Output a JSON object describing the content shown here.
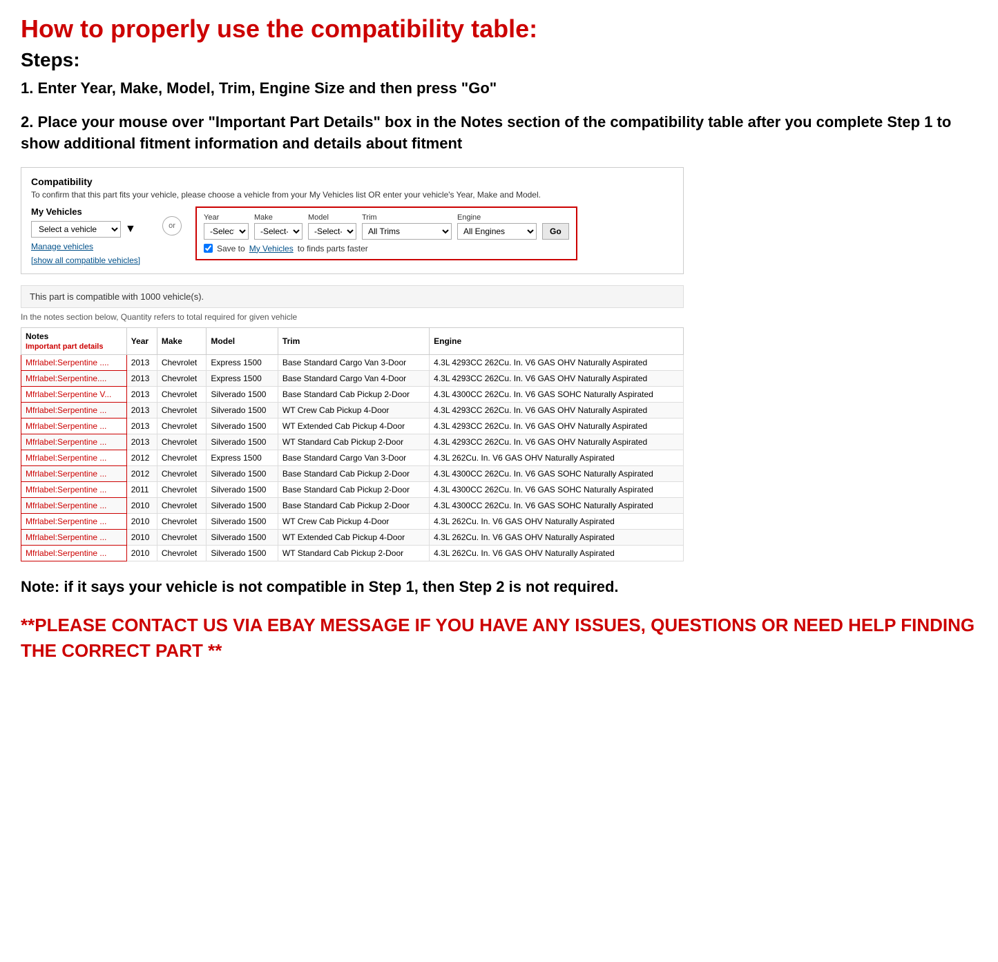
{
  "page": {
    "main_title": "How to properly use the compatibility table:",
    "steps_heading": "Steps:",
    "step1": "1. Enter Year, Make, Model, Trim, Engine Size and then press \"Go\"",
    "step2": "2. Place your mouse over \"Important Part Details\" box in the Notes section of the compatibility table after you complete Step 1 to show additional fitment information and details about fitment",
    "note_text": "Note: if it says your vehicle is not compatible in Step 1, then Step 2 is not required.",
    "contact_text": "**PLEASE CONTACT US VIA EBAY MESSAGE IF YOU HAVE ANY ISSUES, QUESTIONS OR NEED HELP FINDING THE CORRECT PART **"
  },
  "compatibility": {
    "title": "Compatibility",
    "subtitle": "To confirm that this part fits your vehicle, please choose a vehicle from your My Vehicles list OR enter your vehicle's Year, Make and Model.",
    "my_vehicles_label": "My Vehicles",
    "select_vehicle_placeholder": "Select a vehicle",
    "manage_vehicles": "Manage vehicles",
    "show_compatible": "[show all compatible vehicles]",
    "or_label": "or",
    "year_label": "Year",
    "year_value": "-Select-",
    "make_label": "Make",
    "make_value": "-Select-",
    "model_label": "Model",
    "model_value": "-Select-",
    "trim_label": "Trim",
    "trim_value": "All Trims",
    "engine_label": "Engine",
    "engine_value": "All Engines",
    "go_label": "Go",
    "save_label": "Save to",
    "save_link": "My Vehicles",
    "save_suffix": "to finds parts faster",
    "compatible_count": "This part is compatible with 1000 vehicle(s).",
    "quantity_note": "In the notes section below, Quantity refers to total required for given vehicle"
  },
  "table": {
    "headers": [
      "Notes\nImportant part details",
      "Year",
      "Make",
      "Model",
      "Trim",
      "Engine"
    ],
    "rows": [
      {
        "notes": "Mfrlabel:Serpentine ....",
        "year": "2013",
        "make": "Chevrolet",
        "model": "Express 1500",
        "trim": "Base Standard Cargo Van 3-Door",
        "engine": "4.3L 4293CC 262Cu. In. V6 GAS OHV Naturally Aspirated"
      },
      {
        "notes": "Mfrlabel:Serpentine....",
        "year": "2013",
        "make": "Chevrolet",
        "model": "Express 1500",
        "trim": "Base Standard Cargo Van 4-Door",
        "engine": "4.3L 4293CC 262Cu. In. V6 GAS OHV Naturally Aspirated"
      },
      {
        "notes": "Mfrlabel:Serpentine V...",
        "year": "2013",
        "make": "Chevrolet",
        "model": "Silverado 1500",
        "trim": "Base Standard Cab Pickup 2-Door",
        "engine": "4.3L 4300CC 262Cu. In. V6 GAS SOHC Naturally Aspirated"
      },
      {
        "notes": "Mfrlabel:Serpentine ...",
        "year": "2013",
        "make": "Chevrolet",
        "model": "Silverado 1500",
        "trim": "WT Crew Cab Pickup 4-Door",
        "engine": "4.3L 4293CC 262Cu. In. V6 GAS OHV Naturally Aspirated"
      },
      {
        "notes": "Mfrlabel:Serpentine ...",
        "year": "2013",
        "make": "Chevrolet",
        "model": "Silverado 1500",
        "trim": "WT Extended Cab Pickup 4-Door",
        "engine": "4.3L 4293CC 262Cu. In. V6 GAS OHV Naturally Aspirated"
      },
      {
        "notes": "Mfrlabel:Serpentine ...",
        "year": "2013",
        "make": "Chevrolet",
        "model": "Silverado 1500",
        "trim": "WT Standard Cab Pickup 2-Door",
        "engine": "4.3L 4293CC 262Cu. In. V6 GAS OHV Naturally Aspirated"
      },
      {
        "notes": "Mfrlabel:Serpentine ...",
        "year": "2012",
        "make": "Chevrolet",
        "model": "Express 1500",
        "trim": "Base Standard Cargo Van 3-Door",
        "engine": "4.3L 262Cu. In. V6 GAS OHV Naturally Aspirated"
      },
      {
        "notes": "Mfrlabel:Serpentine ...",
        "year": "2012",
        "make": "Chevrolet",
        "model": "Silverado 1500",
        "trim": "Base Standard Cab Pickup 2-Door",
        "engine": "4.3L 4300CC 262Cu. In. V6 GAS SOHC Naturally Aspirated"
      },
      {
        "notes": "Mfrlabel:Serpentine ...",
        "year": "2011",
        "make": "Chevrolet",
        "model": "Silverado 1500",
        "trim": "Base Standard Cab Pickup 2-Door",
        "engine": "4.3L 4300CC 262Cu. In. V6 GAS SOHC Naturally Aspirated"
      },
      {
        "notes": "Mfrlabel:Serpentine ...",
        "year": "2010",
        "make": "Chevrolet",
        "model": "Silverado 1500",
        "trim": "Base Standard Cab Pickup 2-Door",
        "engine": "4.3L 4300CC 262Cu. In. V6 GAS SOHC Naturally Aspirated"
      },
      {
        "notes": "Mfrlabel:Serpentine ...",
        "year": "2010",
        "make": "Chevrolet",
        "model": "Silverado 1500",
        "trim": "WT Crew Cab Pickup 4-Door",
        "engine": "4.3L 262Cu. In. V6 GAS OHV Naturally Aspirated"
      },
      {
        "notes": "Mfrlabel:Serpentine ...",
        "year": "2010",
        "make": "Chevrolet",
        "model": "Silverado 1500",
        "trim": "WT Extended Cab Pickup 4-Door",
        "engine": "4.3L 262Cu. In. V6 GAS OHV Naturally Aspirated"
      },
      {
        "notes": "Mfrlabel:Serpentine ...",
        "year": "2010",
        "make": "Chevrolet",
        "model": "Silverado 1500",
        "trim": "WT Standard Cab Pickup 2-Door",
        "engine": "4.3L 262Cu. In. V6 GAS OHV Naturally Aspirated"
      }
    ]
  }
}
